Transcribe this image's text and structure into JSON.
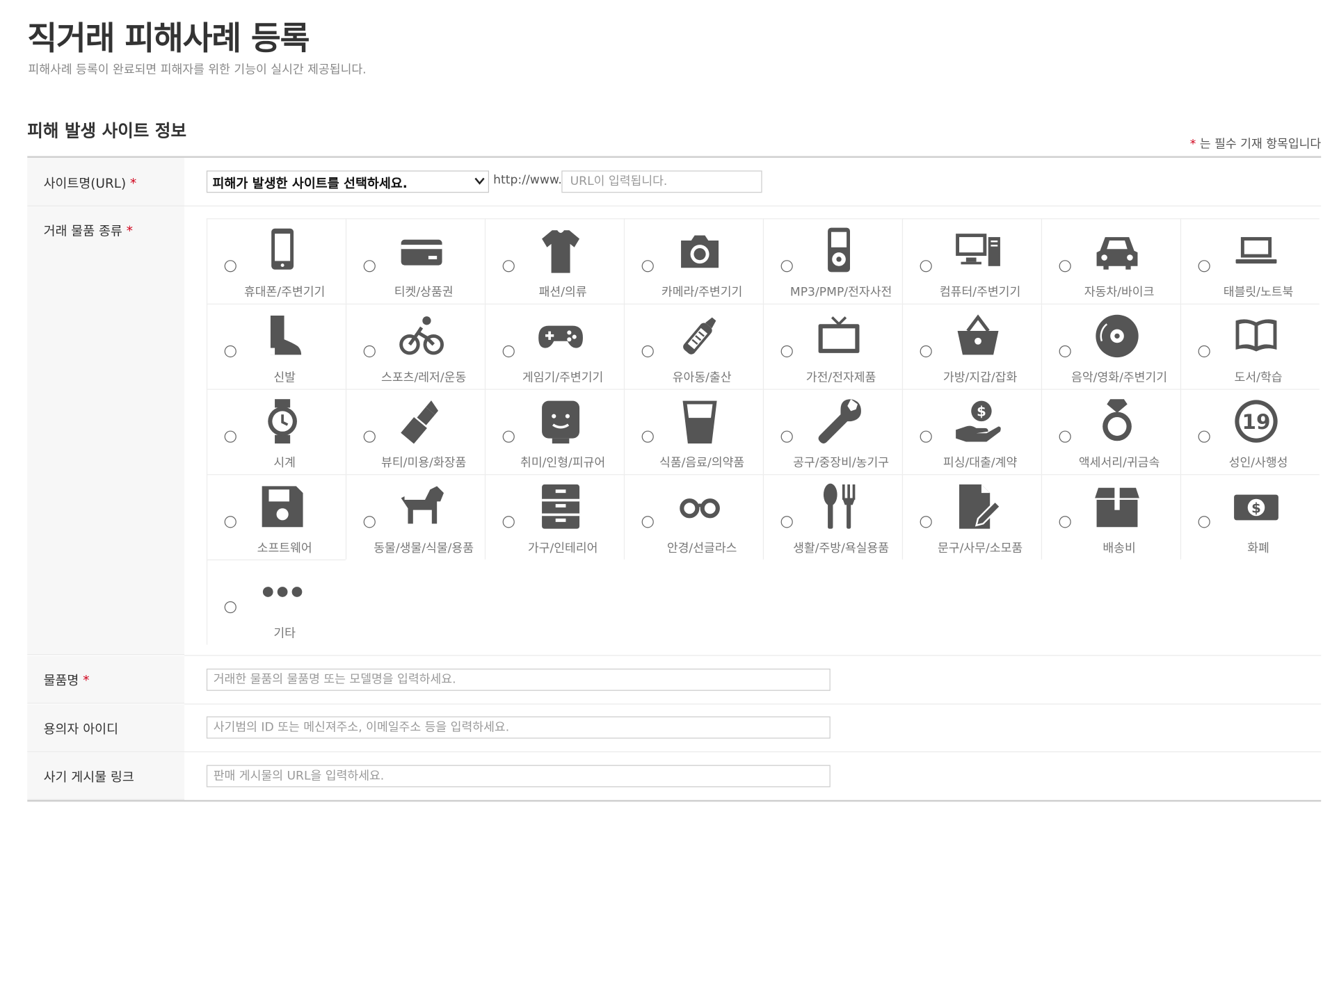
{
  "header": {
    "title": "직거래 피해사례 등록",
    "subtitle": "피해사례 등록이 완료되면 피해자를 위한 기능이 실시간 제공됩니다."
  },
  "section": {
    "title": "피해 발생 사이트 정보",
    "required_star": "*",
    "required_note": "는 필수 기재 항목입니다"
  },
  "form": {
    "site": {
      "label": "사이트명(URL)",
      "select_value": "피해가 발생한 사이트를 선택하세요.",
      "url_prefix": "http://www.",
      "url_placeholder": "URL이 입력됩니다."
    },
    "category": {
      "label": "거래 물품 종류",
      "items": [
        {
          "label": "휴대폰/주변기기",
          "icon": "phone-icon"
        },
        {
          "label": "티켓/상품권",
          "icon": "ticket-icon"
        },
        {
          "label": "패션/의류",
          "icon": "shirt-icon"
        },
        {
          "label": "카메라/주변기기",
          "icon": "camera-icon"
        },
        {
          "label": "MP3/PMP/전자사전",
          "icon": "mp3-icon"
        },
        {
          "label": "컴퓨터/주변기기",
          "icon": "computer-icon"
        },
        {
          "label": "자동차/바이크",
          "icon": "car-icon"
        },
        {
          "label": "태블릿/노트북",
          "icon": "laptop-icon"
        },
        {
          "label": "신발",
          "icon": "boot-icon"
        },
        {
          "label": "스포츠/레저/운동",
          "icon": "bicycle-icon"
        },
        {
          "label": "게임기/주변기기",
          "icon": "gamepad-icon"
        },
        {
          "label": "유아동/출산",
          "icon": "baby-bottle-icon"
        },
        {
          "label": "가전/전자제품",
          "icon": "tv-icon"
        },
        {
          "label": "가방/지갑/잡화",
          "icon": "basket-icon"
        },
        {
          "label": "음악/영화/주변기기",
          "icon": "disc-icon"
        },
        {
          "label": "도서/학습",
          "icon": "book-icon"
        },
        {
          "label": "시계",
          "icon": "watch-icon"
        },
        {
          "label": "뷰티/미용/화장품",
          "icon": "lipstick-icon"
        },
        {
          "label": "취미/인형/피규어",
          "icon": "figure-icon"
        },
        {
          "label": "식품/음료/의약품",
          "icon": "glass-icon"
        },
        {
          "label": "공구/중장비/농기구",
          "icon": "wrench-icon"
        },
        {
          "label": "피싱/대출/계약",
          "icon": "money-hand-icon"
        },
        {
          "label": "액세서리/귀금속",
          "icon": "ring-icon"
        },
        {
          "label": "성인/사행성",
          "icon": "age-19-icon",
          "badge": "19"
        },
        {
          "label": "소프트웨어",
          "icon": "floppy-icon"
        },
        {
          "label": "동물/생물/식물/용품",
          "icon": "dog-icon"
        },
        {
          "label": "가구/인테리어",
          "icon": "drawer-icon"
        },
        {
          "label": "안경/선글라스",
          "icon": "glasses-icon"
        },
        {
          "label": "생활/주방/욕실용품",
          "icon": "utensils-icon"
        },
        {
          "label": "문구/사무/소모품",
          "icon": "document-edit-icon"
        },
        {
          "label": "배송비",
          "icon": "box-icon"
        },
        {
          "label": "화폐",
          "icon": "banknote-icon",
          "badge": "$"
        },
        {
          "label": "기타",
          "icon": "more-icon"
        }
      ]
    },
    "product": {
      "label": "물품명",
      "placeholder": "거래한 물품의 물품명 또는 모델명을 입력하세요."
    },
    "suspect_id": {
      "label": "용의자 아이디",
      "placeholder": "사기범의 ID 또는 메신져주소, 이메일주소 등을 입력하세요."
    },
    "post_link": {
      "label": "사기 게시물 링크",
      "placeholder": "판매 게시물의 URL을 입력하세요."
    }
  },
  "colors": {
    "required": "#d0021b",
    "icon": "#555555",
    "label_bg": "#f7f7f7"
  }
}
